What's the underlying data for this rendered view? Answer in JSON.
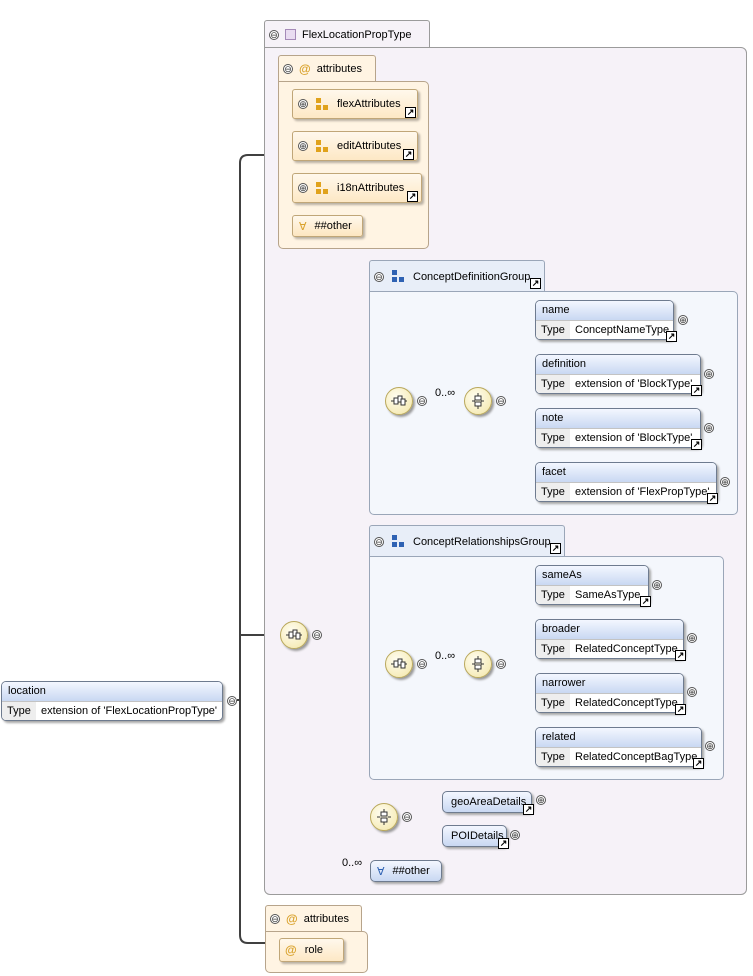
{
  "root_element": {
    "name": "location",
    "type_label": "Type",
    "type": "extension of 'FlexLocationPropType'"
  },
  "complex_type": {
    "name": "FlexLocationPropType"
  },
  "attributes_group": {
    "label": "attributes",
    "items": [
      {
        "name": "flexAttributes"
      },
      {
        "name": "editAttributes"
      },
      {
        "name": "i18nAttributes"
      }
    ],
    "any_attribute": "##other"
  },
  "concept_definition_group": {
    "name": "ConceptDefinitionGroup",
    "occurrence": "0..∞",
    "elements": [
      {
        "name": "name",
        "type_label": "Type",
        "type": "ConceptNameType"
      },
      {
        "name": "definition",
        "type_label": "Type",
        "type": "extension of 'BlockType'"
      },
      {
        "name": "note",
        "type_label": "Type",
        "type": "extension of 'BlockType'"
      },
      {
        "name": "facet",
        "type_label": "Type",
        "type": "extension of 'FlexPropType'"
      }
    ]
  },
  "concept_relationships_group": {
    "name": "ConceptRelationshipsGroup",
    "occurrence": "0..∞",
    "elements": [
      {
        "name": "sameAs",
        "type_label": "Type",
        "type": "SameAsType"
      },
      {
        "name": "broader",
        "type_label": "Type",
        "type": "RelatedConceptType"
      },
      {
        "name": "narrower",
        "type_label": "Type",
        "type": "RelatedConceptType"
      },
      {
        "name": "related",
        "type_label": "Type",
        "type": "RelatedConceptBagType"
      }
    ]
  },
  "choice_elements": [
    {
      "name": "geoAreaDetails"
    },
    {
      "name": "POIDetails"
    }
  ],
  "any_element": {
    "occurrence": "0..∞",
    "label": "##other"
  },
  "outer_attributes": {
    "label": "attributes",
    "items": [
      {
        "name": "role"
      }
    ]
  },
  "symbols": {
    "collapse": "⊖",
    "expand": "⊕",
    "at": "@",
    "any": "∀",
    "link": "↗"
  },
  "colors": {
    "type_bg": "#f6f2f8",
    "attr_bg": "#fff4e3",
    "group_bg": "#f4f7fc",
    "element_header": "#c9d8f2",
    "compositor": "#f3e6a6"
  }
}
